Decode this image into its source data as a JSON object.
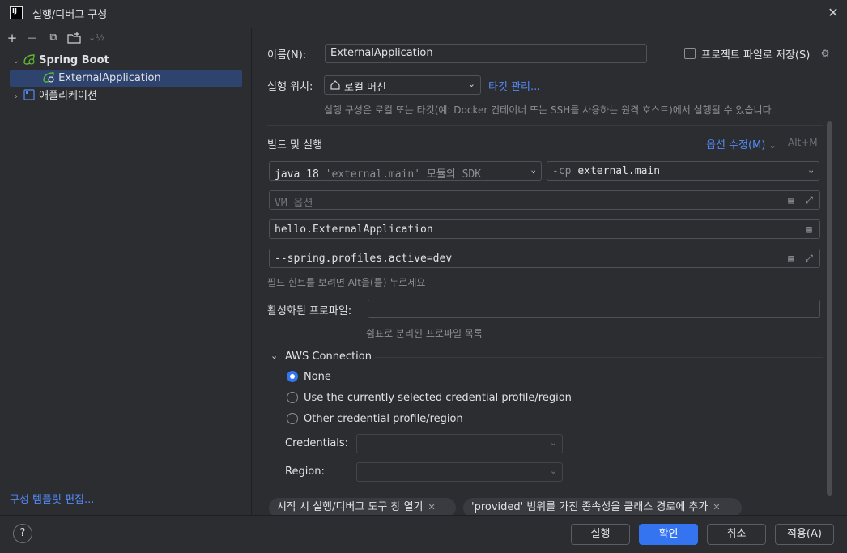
{
  "window": {
    "title": "실행/디버그 구성",
    "logo_text": "IJ"
  },
  "toolbar": {
    "add": "+",
    "remove": "—",
    "copy": "⧉",
    "folder": "▣",
    "sort": "↓½"
  },
  "tree": {
    "spring_boot": "Spring Boot",
    "external_app": "ExternalApplication",
    "application": "애플리케이션"
  },
  "left_footer": {
    "template_link": "구성 템플릿 편집..."
  },
  "form": {
    "name_label": "이름(N):",
    "name_value": "ExternalApplication",
    "store_label": "프로젝트 파일로 저장(S)",
    "run_on_label": "실행 위치:",
    "run_on_value": "로컬 머신",
    "manage_targets": "타깃 관리...",
    "run_on_hint": "실행 구성은 로컬 또는 타깃(예: Docker 컨테이너 또는 SSH를 사용하는 원격 호스트)에서 실행될 수 있습니다.",
    "build_run_title": "빌드 및 실행",
    "modify_options": "옵션 수정(M)",
    "modify_shortcut": "Alt+M",
    "jre_value_java": "java 18",
    "jre_value_module": "'external.main'",
    "jre_value_rest": "모듈의 SDK",
    "cp_flag": "-cp",
    "cp_value": "external.main",
    "vm_placeholder": "VM 옵션",
    "main_class": "hello.ExternalApplication",
    "program_args": "--spring.profiles.active=dev",
    "field_hint": "필드 힌트를 보려면 Alt을(를) 누르세요",
    "active_profiles_label": "활성화된 프로파일:",
    "active_profiles_value": "",
    "active_profiles_hint": "쉼표로 분리된 프로파일 목록"
  },
  "aws": {
    "title": "AWS Connection",
    "options": [
      {
        "label": "None",
        "selected": true
      },
      {
        "label": "Use the currently selected credential profile/region",
        "selected": false
      },
      {
        "label": "Other credential profile/region",
        "selected": false
      }
    ],
    "credentials_label": "Credentials:",
    "credentials_value": "",
    "region_label": "Region:",
    "region_value": ""
  },
  "chips": [
    "시작 시 실행/디버그 도구 창 열기",
    "'provided' 범위를 가진 종속성을 클래스 경로에 추가"
  ],
  "buttons": {
    "help": "?",
    "run": "실행",
    "ok": "확인",
    "cancel": "취소",
    "apply": "적용(A)"
  },
  "colors": {
    "accent": "#3574f0",
    "link": "#548af7",
    "spring_green": "#5fb832",
    "selection": "#2e436e"
  }
}
